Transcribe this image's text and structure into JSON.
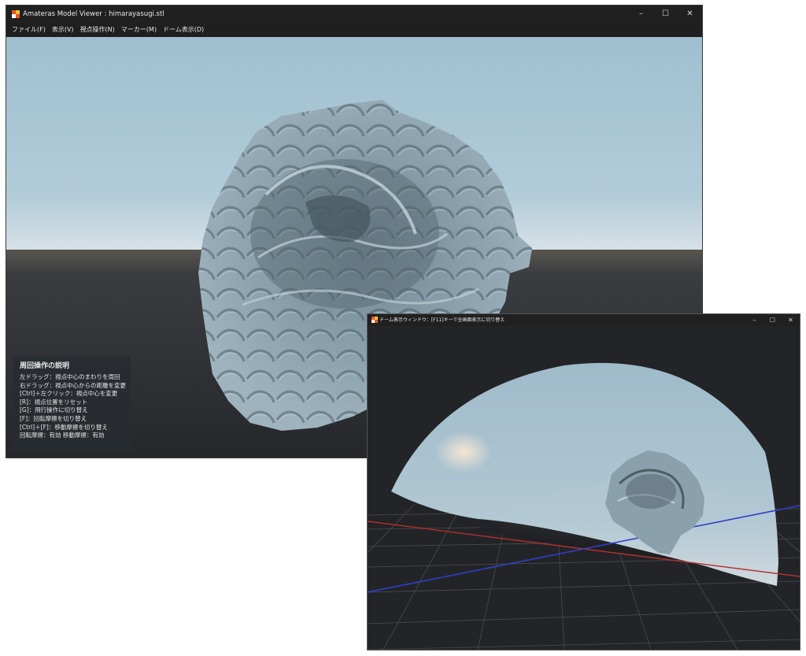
{
  "main_window": {
    "title": "Amateras Model Viewer : himarayasugi.stl",
    "controls": {
      "minimize": "–",
      "maximize": "☐",
      "close": "✕"
    },
    "menu": [
      "ファイル(F)",
      "表示(V)",
      "視点操作(N)",
      "マーカー(M)",
      "ドーム表示(D)"
    ],
    "help": {
      "title": "周回操作の説明",
      "lines": [
        "左ドラッグ：視点中心のまわりを周回",
        "右ドラッグ：視点中心からの距離を変更",
        "[Ctrl]＋左クリック：視点中心を変更",
        "[R]：視点位置をリセット",
        "[G]：飛行操作に切り替え",
        "[F]：回転摩擦を切り替え",
        "[Ctrl]＋[F]：移動摩擦を切り替え",
        "回転摩擦：有効 移動摩擦：有効"
      ]
    }
  },
  "dome_window": {
    "title": "ドーム表示ウィンドウ：[F11]キーで全画面表示に切り替え",
    "controls": {
      "minimize": "–",
      "maximize": "☐",
      "close": "✕"
    }
  },
  "colors": {
    "sky_top": "#a6c3d2",
    "horizon": "#c9d7df",
    "ground": "#2b2d31",
    "model": "#8ea4b0",
    "titlebar": "#202020",
    "icon_colors": [
      "#e8542a",
      "#f2c32f",
      "#ffffff",
      "#e8542a"
    ]
  }
}
